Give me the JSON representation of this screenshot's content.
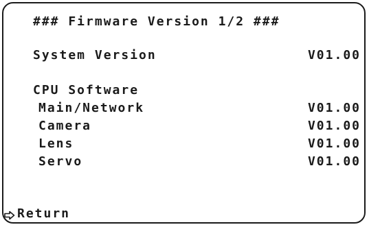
{
  "menu": {
    "title": "### Firmware Version 1/2 ###",
    "system_version": {
      "label": "System Version",
      "value": "V01.00"
    },
    "cpu_software": {
      "label": "CPU Software",
      "items": [
        {
          "label": "Main/Network",
          "value": "V01.00"
        },
        {
          "label": "Camera",
          "value": "V01.00"
        },
        {
          "label": "Lens",
          "value": "V01.00"
        },
        {
          "label": "Servo",
          "value": "V01.00"
        }
      ]
    },
    "return": {
      "icon": "right-arrow-outline-icon",
      "label": "Return"
    }
  }
}
